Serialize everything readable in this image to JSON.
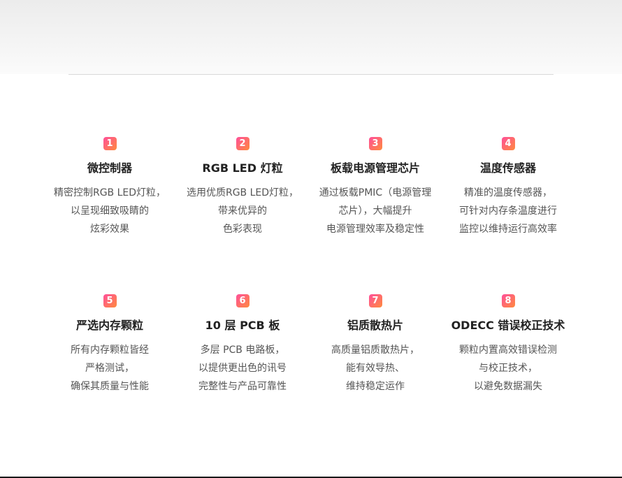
{
  "features": [
    {
      "num": "1",
      "title": "微控制器",
      "lines": [
        "精密控制RGB LED灯粒，",
        "以呈现细致吸睛的",
        "炫彩效果"
      ]
    },
    {
      "num": "2",
      "title": "RGB LED 灯粒",
      "lines": [
        "选用优质RGB LED灯粒，",
        "带来优异的",
        "色彩表现"
      ]
    },
    {
      "num": "3",
      "title": "板载电源管理芯片",
      "lines": [
        "通过板载PMIC（电源管理",
        "芯片），大幅提升",
        "电源管理效率及稳定性"
      ]
    },
    {
      "num": "4",
      "title": "温度传感器",
      "lines": [
        "精准的温度传感器，",
        "可针对内存条温度进行",
        "监控以维持运行高效率"
      ]
    },
    {
      "num": "5",
      "title": "严选内存颗粒",
      "lines": [
        "所有内存颗粒皆经",
        "严格测试，",
        "确保其质量与性能"
      ]
    },
    {
      "num": "6",
      "title": "10 层 PCB 板",
      "lines": [
        "多层 PCB 电路板，",
        "以提供更出色的讯号",
        "完整性与产品可靠性"
      ]
    },
    {
      "num": "7",
      "title": "铝质散热片",
      "lines": [
        "高质量铝质散热片，",
        "能有效导热、",
        "维持稳定运作"
      ]
    },
    {
      "num": "8",
      "title": "ODECC 错误校正技术",
      "lines": [
        "颗粒内置高效错误检测",
        "与校正技术，",
        "以避免数据漏失"
      ]
    }
  ],
  "colors": {
    "badge_start": "#ff4f9a",
    "badge_end": "#ff8a3d",
    "title": "#222222",
    "text": "#555555"
  }
}
